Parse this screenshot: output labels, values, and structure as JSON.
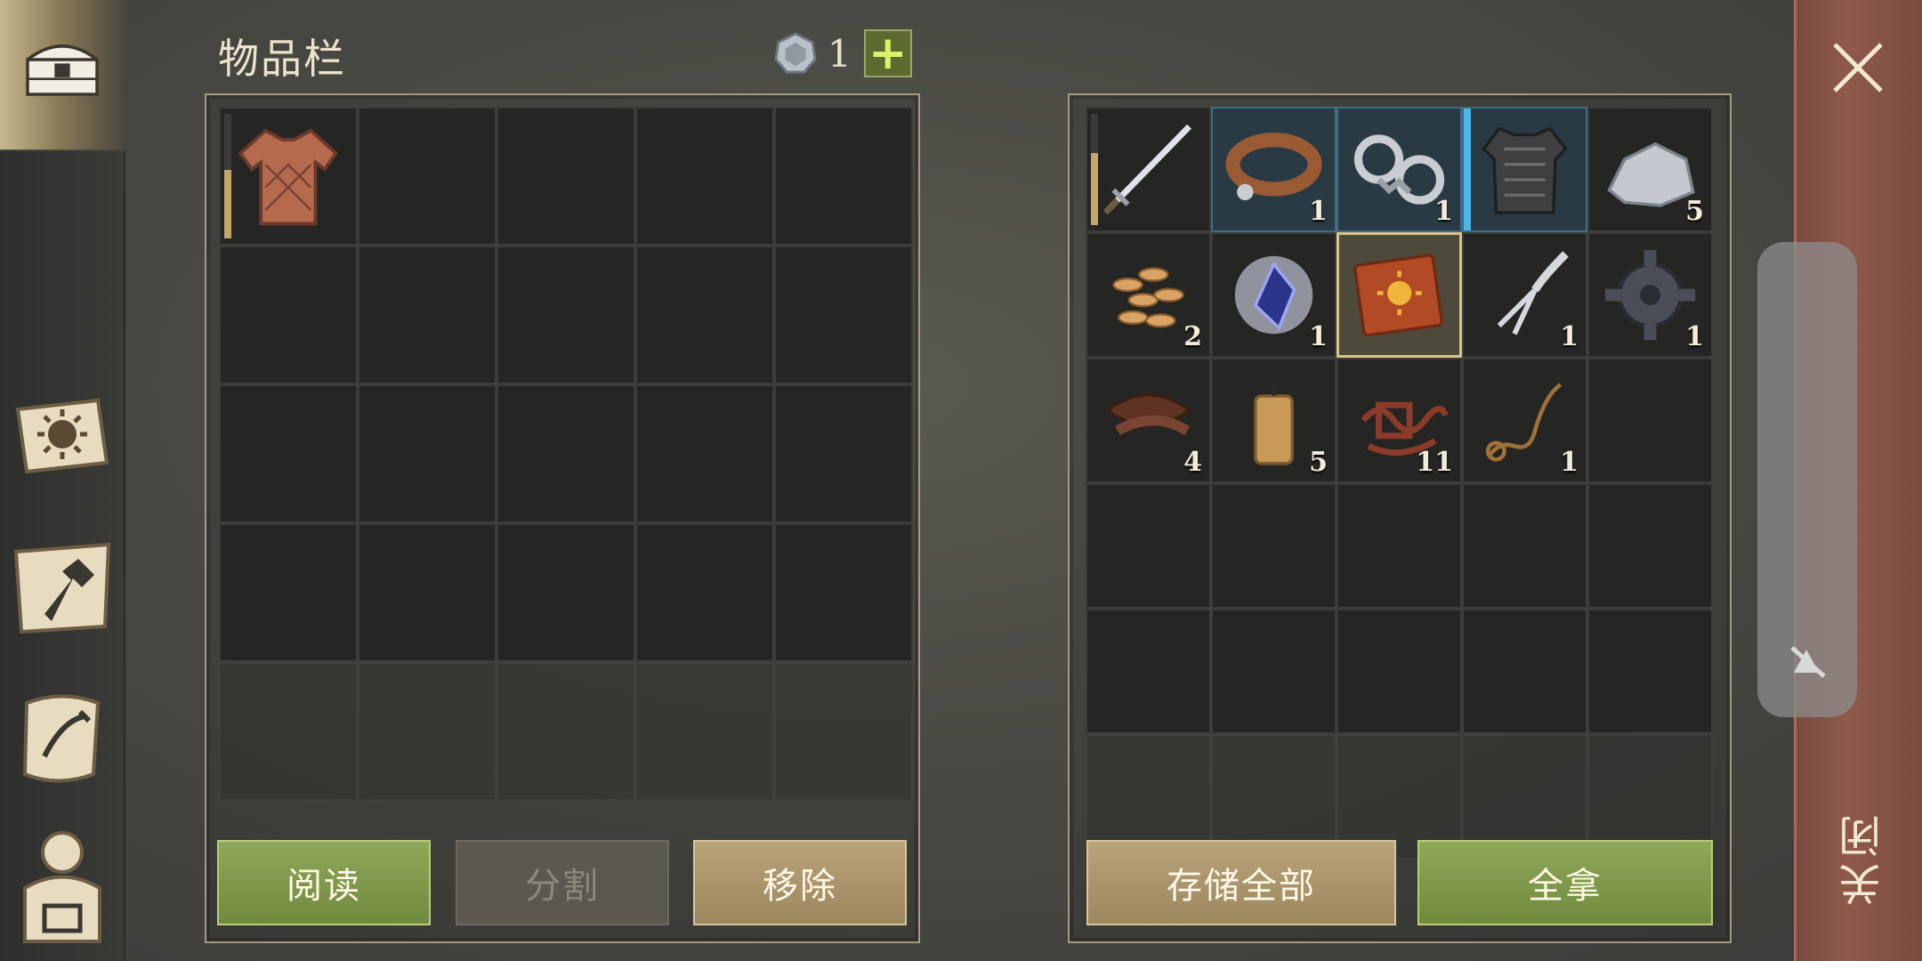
{
  "inventory": {
    "title": "物品栏",
    "currency_count": "1",
    "plus_label": "+",
    "slots": [
      {
        "icon": "quilted-armor-icon",
        "qty": "",
        "durability": 0.55
      },
      {},
      {},
      {},
      {},
      {},
      {},
      {},
      {},
      {},
      {},
      {},
      {},
      {},
      {},
      {},
      {},
      {},
      {},
      {},
      {},
      {},
      {},
      {},
      {}
    ],
    "buttons": {
      "read": "阅读",
      "split": "分割",
      "remove": "移除"
    }
  },
  "container": {
    "slots": [
      {
        "icon": "sword-icon",
        "qty": "",
        "durability": 0.65
      },
      {
        "icon": "collar-icon",
        "qty": "1",
        "blue": true
      },
      {
        "icon": "shackles-icon",
        "qty": "1",
        "blue": true
      },
      {
        "icon": "chainmail-icon",
        "qty": "",
        "blue": true,
        "bar": true
      },
      {
        "icon": "stone-icon",
        "qty": "5"
      },
      {
        "icon": "seeds-icon",
        "qty": "2"
      },
      {
        "icon": "crystal-icon",
        "qty": "1"
      },
      {
        "icon": "sun-book-icon",
        "qty": "",
        "selected": true
      },
      {
        "icon": "fork-tool-icon",
        "qty": "1"
      },
      {
        "icon": "gear-icon",
        "qty": "1"
      },
      {
        "icon": "leather-icon",
        "qty": "4"
      },
      {
        "icon": "candle-icon",
        "qty": "5"
      },
      {
        "icon": "rope-scraps-icon",
        "qty": "11"
      },
      {
        "icon": "rope-icon",
        "qty": "1"
      },
      {},
      {},
      {},
      {},
      {},
      {},
      {},
      {},
      {},
      {},
      {},
      {},
      {},
      {},
      {},
      {}
    ],
    "buttons": {
      "store_all": "存储全部",
      "take_all": "全拿"
    }
  },
  "close_label": "关闭",
  "colors": {
    "accent_green": "#8fa85a",
    "tan": "#b9a37b",
    "strip": "#8f5a4c"
  }
}
